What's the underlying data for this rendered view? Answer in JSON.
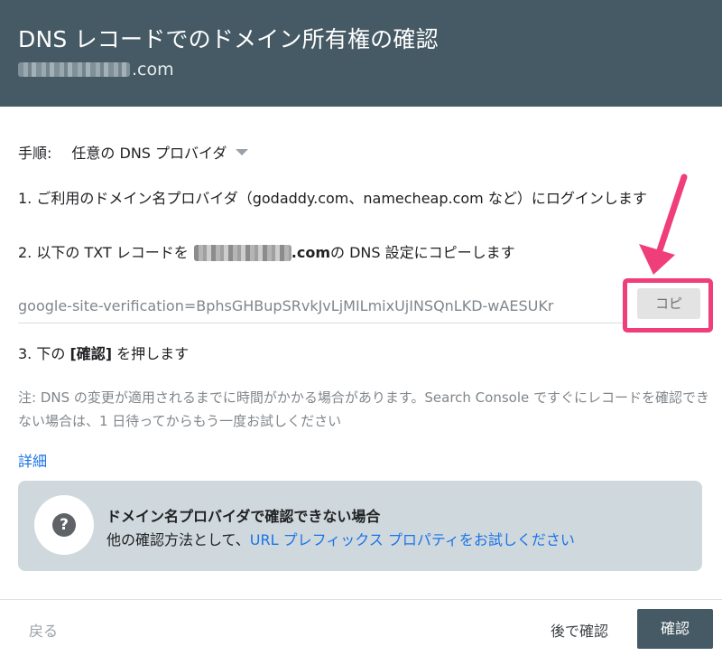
{
  "header": {
    "title": "DNS レコードでのドメイン所有権の確認",
    "domain_suffix": ".com"
  },
  "method": {
    "label": "手順:",
    "value": "任意の DNS プロバイダ"
  },
  "steps": {
    "step1": "1. ご利用のドメイン名プロバイダ（godaddy.com、namecheap.com など）にログインします",
    "step2_prefix": "2. 以下の TXT レコードを",
    "step2_domain_suffix": ".com",
    "step2_suffix": " の DNS 設定にコピーします",
    "step3_prefix": "3. 下の ",
    "step3_bold": "[確認]",
    "step3_suffix": " を押します"
  },
  "txt_record": {
    "value": "google-site-verification=BphsGHBupSRvkJvLjMILmixUjINSQnLKD-wAESUKr"
  },
  "copy_button": {
    "label": "コピ"
  },
  "note": "注: DNS の変更が適用されるまでに時間がかかる場合があります。Search Console ですぐにレコードを確認できない場合は、1 日待ってからもう一度お試しください",
  "details_link": "詳細",
  "info_card": {
    "icon_glyph": "?",
    "heading": "ドメイン名プロバイダで確認できない場合",
    "desc_prefix": "他の確認方法として、",
    "desc_link": "URL プレフィックス プロパティをお試しください"
  },
  "footer": {
    "back": "戻る",
    "later": "後で確認",
    "confirm": "確認"
  },
  "colors": {
    "header_bg": "#455a64",
    "highlight": "#ef3e7a",
    "link": "#1a73e8",
    "card_bg": "#cfd8dc"
  },
  "icons": {
    "question": "question-mark-icon",
    "dropdown": "caret-down-icon",
    "annotation": "arrow-annotation"
  }
}
